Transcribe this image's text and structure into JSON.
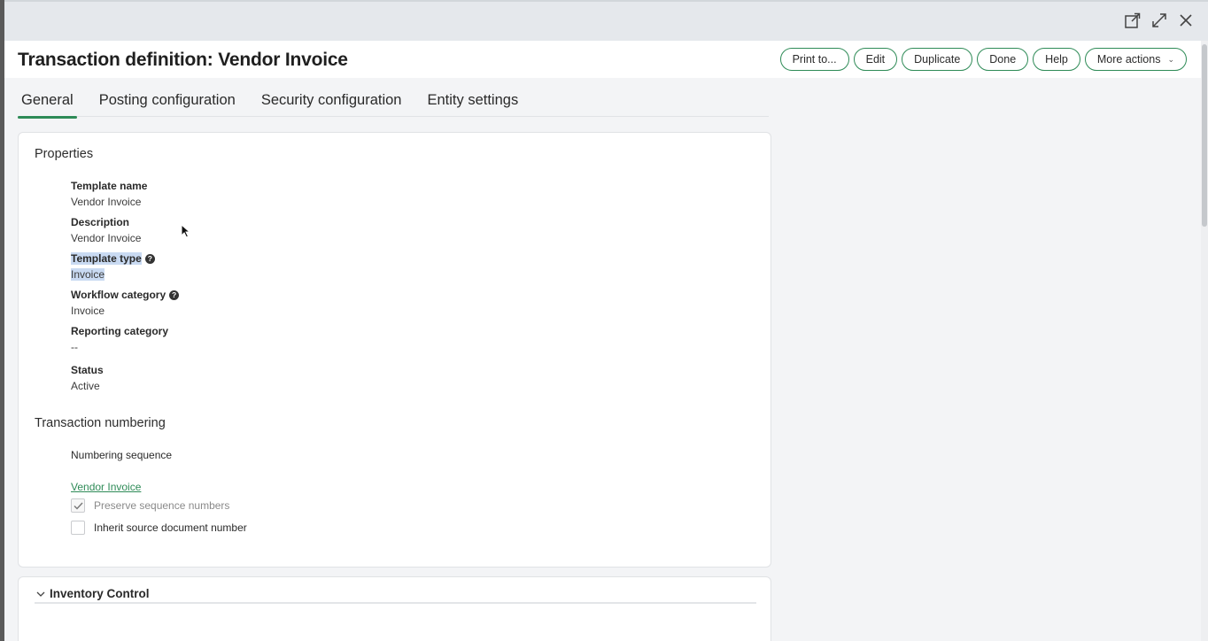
{
  "window": {
    "icons": [
      "open-external-icon",
      "expand-icon",
      "close-icon"
    ]
  },
  "header": {
    "title": "Transaction definition: Vendor Invoice",
    "actions": {
      "print": "Print to...",
      "edit": "Edit",
      "duplicate": "Duplicate",
      "done": "Done",
      "help": "Help",
      "more": "More actions"
    }
  },
  "tabs": [
    {
      "label": "General",
      "active": true
    },
    {
      "label": "Posting configuration",
      "active": false
    },
    {
      "label": "Security configuration",
      "active": false
    },
    {
      "label": "Entity settings",
      "active": false
    }
  ],
  "properties": {
    "title": "Properties",
    "template_name": {
      "label": "Template name",
      "value": "Vendor Invoice"
    },
    "description": {
      "label": "Description",
      "value": "Vendor Invoice"
    },
    "template_type": {
      "label": "Template type",
      "value": "Invoice"
    },
    "workflow_category": {
      "label": "Workflow category",
      "value": "Invoice"
    },
    "reporting_category": {
      "label": "Reporting category",
      "value": "--"
    },
    "status": {
      "label": "Status",
      "value": "Active"
    }
  },
  "numbering": {
    "title": "Transaction numbering",
    "sequence_label": "Numbering sequence",
    "sequence_link": "Vendor Invoice",
    "preserve": {
      "label": "Preserve sequence numbers",
      "checked": true
    },
    "inherit": {
      "label": "Inherit source document number",
      "checked": false
    }
  },
  "inventory": {
    "title": "Inventory Control"
  },
  "colors": {
    "accent": "#2e8b57",
    "highlight": "#c9daf2"
  }
}
